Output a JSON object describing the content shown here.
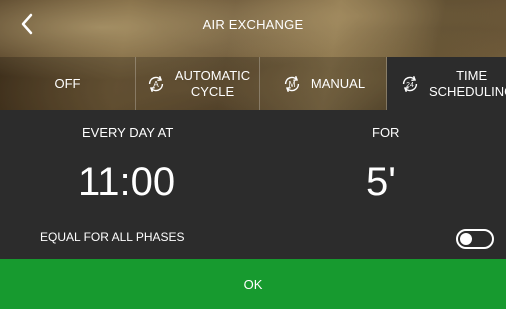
{
  "header": {
    "title": "AIR EXCHANGE"
  },
  "tabs": [
    {
      "label": "OFF",
      "icon": "none",
      "active": false
    },
    {
      "label_line1": "AUTOMATIC",
      "label_line2": "CYCLE",
      "icon": "auto-cycle-icon",
      "icon_letter": "A",
      "active": false
    },
    {
      "label": "MANUAL",
      "icon": "manual-icon",
      "icon_letter": "M",
      "active": false
    },
    {
      "label_line1": "TIME",
      "label_line2": "SCHEDULING",
      "icon": "time-scheduling-icon",
      "icon_letter": "24",
      "active": true
    }
  ],
  "schedule": {
    "every_day_label": "EVERY DAY AT",
    "time": "11:00",
    "for_label": "FOR",
    "duration": "5'"
  },
  "equal_phases": {
    "label": "EQUAL FOR ALL PHASES",
    "enabled": false
  },
  "ok_button": {
    "label": "OK"
  },
  "colors": {
    "ok_green": "#179a2f",
    "panel": "#2c2c2c"
  }
}
